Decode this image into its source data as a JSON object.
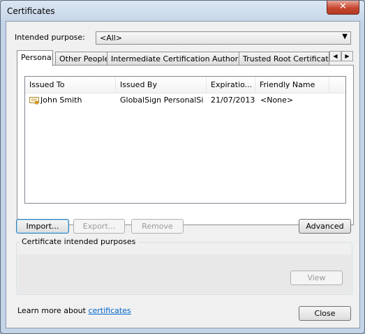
{
  "window": {
    "title": "Certificates",
    "close_glyph": "✕"
  },
  "purpose": {
    "label": "Intended purpose:",
    "value": "<All>"
  },
  "tabs": [
    {
      "label": "Personal"
    },
    {
      "label": "Other People"
    },
    {
      "label": "Intermediate Certification Authorities"
    },
    {
      "label": "Trusted Root Certification"
    }
  ],
  "list": {
    "columns": [
      "Issued To",
      "Issued By",
      "Expiratio...",
      "Friendly Name"
    ],
    "rows": [
      {
        "issued_to": "John Smith",
        "issued_by": "GlobalSign PersonalSi...",
        "expiration": "21/07/2013",
        "friendly_name": "<None>"
      }
    ]
  },
  "buttons": {
    "import": "Import...",
    "export": "Export...",
    "remove": "Remove",
    "advanced": "Advanced",
    "view": "View",
    "close": "Close"
  },
  "group": {
    "label": "Certificate intended purposes"
  },
  "footer": {
    "text": "Learn more about ",
    "link": "certificates"
  },
  "icons": {
    "cert": "certificate-icon",
    "close": "close-icon"
  }
}
